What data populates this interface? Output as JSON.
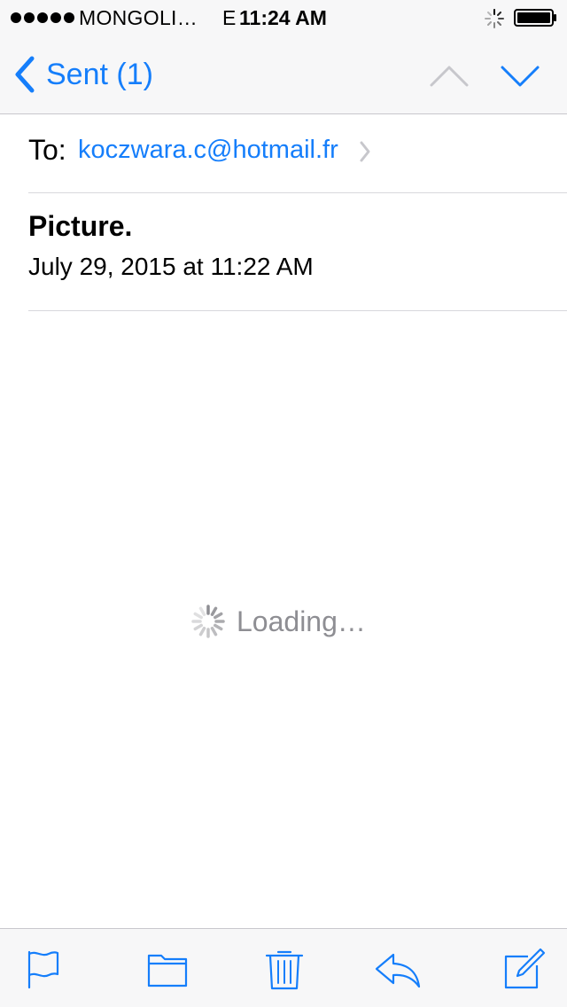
{
  "status_bar": {
    "carrier": "MONGOLI…",
    "network": "E",
    "time": "11:24 AM"
  },
  "nav": {
    "back_label": "Sent (1)",
    "back_icon": "chevron-left-icon",
    "up_icon": "chevron-up-icon",
    "down_icon": "chevron-down-icon"
  },
  "message": {
    "to_label": "To:",
    "recipient": "koczwara.c@hotmail.fr",
    "subject": "Picture.",
    "date": "July 29, 2015 at 11:22 AM"
  },
  "body": {
    "loading_text": "Loading…"
  },
  "toolbar": {
    "items": [
      "flag-icon",
      "folder-icon",
      "trash-icon",
      "reply-icon",
      "compose-icon"
    ]
  },
  "colors": {
    "accent": "#157efb",
    "chrome_bg": "#f7f7f8",
    "muted": "#8e8e93",
    "disabled": "#c7c7cc"
  }
}
